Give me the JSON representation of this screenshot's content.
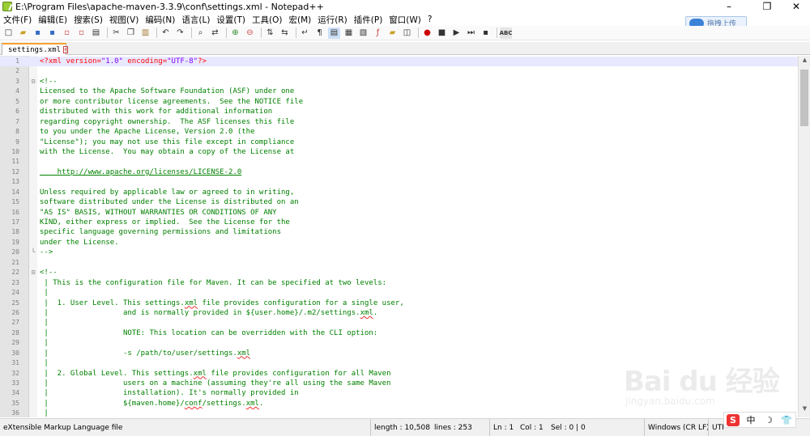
{
  "window": {
    "title": "E:\\Program Files\\apache-maven-3.3.9\\conf\\settings.xml - Notepad++",
    "minimize": "–",
    "maximize": "❐",
    "close": "✕"
  },
  "menu": [
    "文件(F)",
    "编辑(E)",
    "搜索(S)",
    "视图(V)",
    "编码(N)",
    "语言(L)",
    "设置(T)",
    "工具(O)",
    "宏(M)",
    "运行(R)",
    "插件(P)",
    "窗口(W)",
    "?"
  ],
  "baidu": {
    "label": "拖拽上传"
  },
  "tab": {
    "name": "settings.xml",
    "close": "✕"
  },
  "editor": {
    "lines": [
      {
        "n": "1",
        "fold": "",
        "code": "<?xml version=\"1.0\" encoding=\"UTF-8\"?>",
        "type": "decl"
      },
      {
        "n": "2",
        "fold": "",
        "code": "",
        "type": "plain"
      },
      {
        "n": "3",
        "fold": "⊟",
        "code": "<!--",
        "type": "plain"
      },
      {
        "n": "4",
        "fold": "",
        "code": "Licensed to the Apache Software Foundation (ASF) under one",
        "type": "plain"
      },
      {
        "n": "5",
        "fold": "",
        "code": "or more contributor license agreements.  See the NOTICE file",
        "type": "plain"
      },
      {
        "n": "6",
        "fold": "",
        "code": "distributed with this work for additional information",
        "type": "plain"
      },
      {
        "n": "7",
        "fold": "",
        "code": "regarding copyright ownership.  The ASF licenses this file",
        "type": "plain"
      },
      {
        "n": "8",
        "fold": "",
        "code": "to you under the Apache License, Version 2.0 (the",
        "type": "plain"
      },
      {
        "n": "9",
        "fold": "",
        "code": "\"License\"); you may not use this file except in compliance",
        "type": "plain"
      },
      {
        "n": "10",
        "fold": "",
        "code": "with the License.  You may obtain a copy of the License at",
        "type": "plain"
      },
      {
        "n": "11",
        "fold": "",
        "code": "",
        "type": "plain"
      },
      {
        "n": "12",
        "fold": "",
        "code": "    http://www.apache.org/licenses/LICENSE-2.0",
        "type": "link"
      },
      {
        "n": "13",
        "fold": "",
        "code": "",
        "type": "plain"
      },
      {
        "n": "14",
        "fold": "",
        "code": "Unless required by applicable law or agreed to in writing,",
        "type": "plain"
      },
      {
        "n": "15",
        "fold": "",
        "code": "software distributed under the License is distributed on an",
        "type": "plain"
      },
      {
        "n": "16",
        "fold": "",
        "code": "\"AS IS\" BASIS, WITHOUT WARRANTIES OR CONDITIONS OF ANY",
        "type": "plain"
      },
      {
        "n": "17",
        "fold": "",
        "code": "KIND, either express or implied.  See the License for the",
        "type": "plain"
      },
      {
        "n": "18",
        "fold": "",
        "code": "specific language governing permissions and limitations",
        "type": "plain"
      },
      {
        "n": "19",
        "fold": "",
        "code": "under the License.",
        "type": "plain"
      },
      {
        "n": "20",
        "fold": "└",
        "code": "-->",
        "type": "plain"
      },
      {
        "n": "21",
        "fold": "",
        "code": "",
        "type": "plain"
      },
      {
        "n": "22",
        "fold": "⊟",
        "code": "<!--",
        "type": "plain"
      },
      {
        "n": "23",
        "fold": "",
        "code": " | This is the configuration file for Maven. It can be specified at two levels:",
        "type": "plain"
      },
      {
        "n": "24",
        "fold": "",
        "code": " |",
        "type": "plain"
      },
      {
        "n": "25",
        "fold": "",
        "code": " |  1. User Level. This settings.xml file provides configuration for a single user,",
        "type": "plain"
      },
      {
        "n": "26",
        "fold": "",
        "code": " |                 and is normally provided in ${user.home}/.m2/settings.xml.",
        "type": "plain"
      },
      {
        "n": "27",
        "fold": "",
        "code": " |",
        "type": "plain"
      },
      {
        "n": "28",
        "fold": "",
        "code": " |                 NOTE: This location can be overridden with the CLI option:",
        "type": "plain"
      },
      {
        "n": "29",
        "fold": "",
        "code": " |",
        "type": "plain"
      },
      {
        "n": "30",
        "fold": "",
        "code": " |                 -s /path/to/user/settings.xml",
        "type": "plain"
      },
      {
        "n": "31",
        "fold": "",
        "code": " |",
        "type": "plain"
      },
      {
        "n": "32",
        "fold": "",
        "code": " |  2. Global Level. This settings.xml file provides configuration for all Maven",
        "type": "plain"
      },
      {
        "n": "33",
        "fold": "",
        "code": " |                 users on a machine (assuming they're all using the same Maven",
        "type": "plain"
      },
      {
        "n": "34",
        "fold": "",
        "code": " |                 installation). It's normally provided in",
        "type": "plain"
      },
      {
        "n": "35",
        "fold": "",
        "code": " |                 ${maven.home}/conf/settings.xml.",
        "type": "plain"
      },
      {
        "n": "36",
        "fold": "",
        "code": " |",
        "type": "plain"
      }
    ]
  },
  "status": {
    "language": "eXtensible Markup Language file",
    "length": "length : 10,508",
    "lines": "lines : 253",
    "ln": "Ln : 1",
    "col": "Col : 1",
    "sel": "Sel : 0 | 0",
    "eol": "Windows (CR LF)",
    "enc": "UTF"
  },
  "ime": {
    "s": "S",
    "lang": "中",
    "moon": "☽",
    "shirt": "👕"
  },
  "watermark": {
    "main": "Bai du 经验",
    "sub": "jingyan.baidu.com"
  },
  "colors": {
    "comment": "#008000",
    "decl": "#ff0000",
    "value": "#8000ff",
    "tabAccent": "#f7a12d"
  }
}
